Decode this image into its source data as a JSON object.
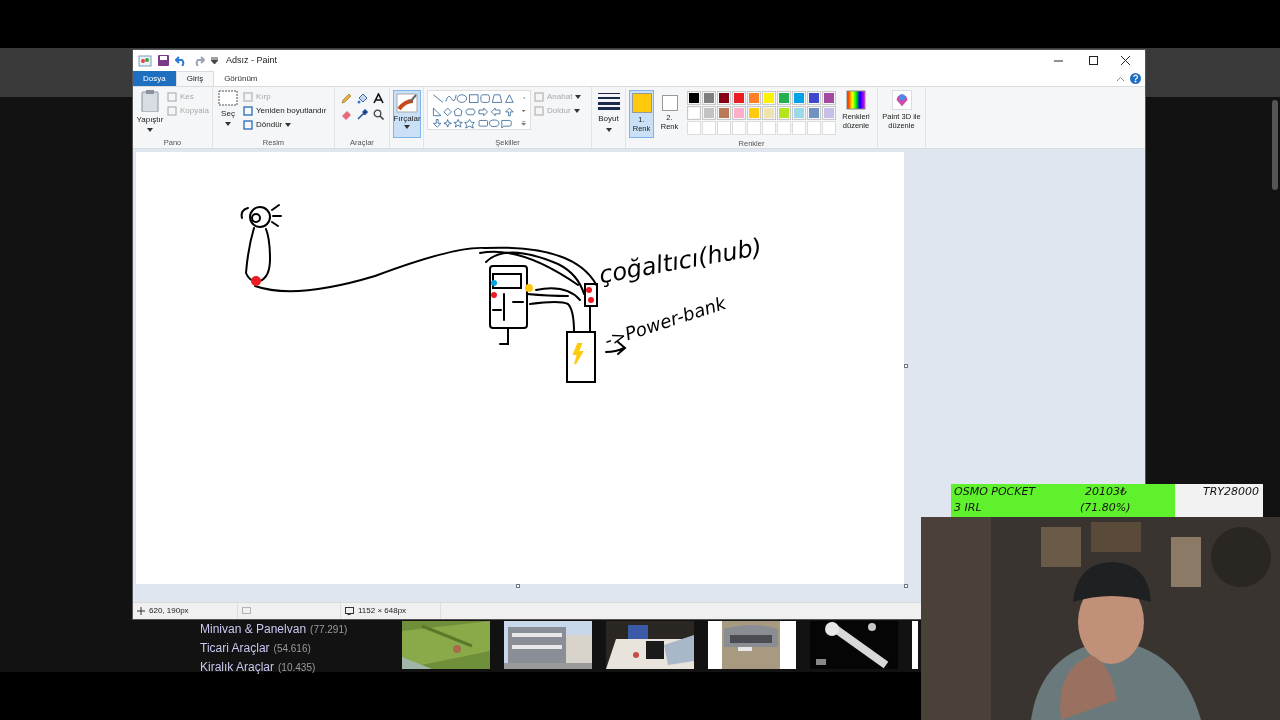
{
  "window": {
    "title": "Adsız - Paint"
  },
  "ribbon_tabs": [
    {
      "label": "Dosya",
      "kind": "file",
      "selected": false
    },
    {
      "label": "Giriş",
      "kind": "tab",
      "selected": true
    },
    {
      "label": "Görünüm",
      "kind": "tab",
      "selected": false
    }
  ],
  "pano": {
    "label": "Pano",
    "paste": "Yapıştır",
    "items": [
      {
        "label": "Kes",
        "disabled": true
      },
      {
        "label": "Kopyala",
        "disabled": true
      }
    ]
  },
  "resim": {
    "label": "Resim",
    "select": "Seç",
    "items": [
      {
        "label": "Kırp",
        "disabled": true
      },
      {
        "label": "Yeniden boyutlandır",
        "disabled": false
      },
      {
        "label": "Döndür",
        "disabled": false
      }
    ]
  },
  "araclar": {
    "label": "Araçlar"
  },
  "brushes": {
    "label": "Fırçalar",
    "selected": true
  },
  "shapes": {
    "label": "Şekiller",
    "items": [
      {
        "label": "Anahat",
        "disabled": true
      },
      {
        "label": "Doldur",
        "disabled": true
      }
    ]
  },
  "size": {
    "label": "Boyut"
  },
  "colors": {
    "label": "Renkler",
    "color_1": {
      "label": "1. Renk",
      "color": "#ffc90e",
      "selected": true
    },
    "color_2": {
      "label": "2. Renk",
      "color": "#ffffff",
      "selected": false
    },
    "palette": [
      {
        "color": "#000000"
      },
      {
        "color": "#7f7f7f"
      },
      {
        "color": "#880015"
      },
      {
        "color": "#ed1c24"
      },
      {
        "color": "#ff7f27"
      },
      {
        "color": "#fff200"
      },
      {
        "color": "#22b14c"
      },
      {
        "color": "#00a2e8"
      },
      {
        "color": "#3f48cc"
      },
      {
        "color": "#a349a4"
      },
      {
        "color": "#ffffff"
      },
      {
        "color": "#c3c3c3"
      },
      {
        "color": "#b97a57"
      },
      {
        "color": "#ffaec9"
      },
      {
        "color": "#ffc90e"
      },
      {
        "color": "#efe4b0"
      },
      {
        "color": "#b5e61d"
      },
      {
        "color": "#99d9ea"
      },
      {
        "color": "#7092be"
      },
      {
        "color": "#c8bfe7"
      }
    ],
    "edit_colors": "Renkleri düzenle"
  },
  "paint3d": "Paint 3D ile düzenle",
  "canvas": {
    "notes": [
      {
        "text": "çoğaltıcı(hub)"
      },
      {
        "text": "->Power-bank"
      }
    ]
  },
  "status_bar": {
    "cursor_position": "620, 190px",
    "canvas_size": "1152 × 648px"
  },
  "website": {
    "categories": [
      {
        "name": "Minivan & Panelvan",
        "count": "(77.291)"
      },
      {
        "name": "Ticari Araçlar",
        "count": "(54.616)"
      },
      {
        "name": "Kiralık Araçlar",
        "count": "(10.435)"
      }
    ]
  },
  "donation": {
    "title": "OSMO POCKET",
    "subtitle": "3 IRL",
    "amount": "20103₺",
    "percent": "(71.80%)",
    "goal": "TRY28000",
    "level": 0.718
  }
}
